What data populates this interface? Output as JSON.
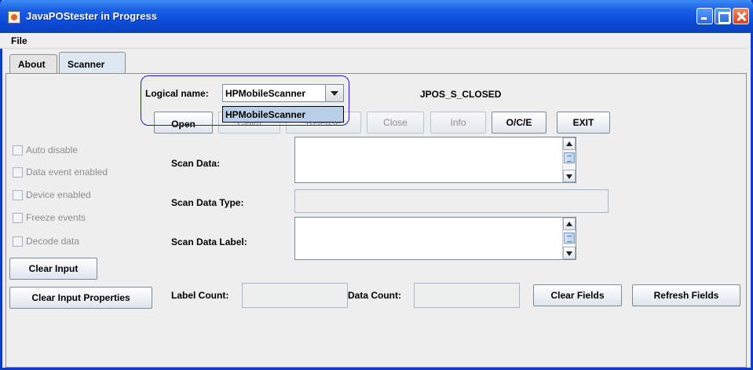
{
  "window": {
    "title": "JavaPOStester in Progress"
  },
  "menu": {
    "file": "File"
  },
  "tabs": [
    {
      "label": "About"
    },
    {
      "label": "Scanner"
    }
  ],
  "device": {
    "logical_name_label": "Logical name:",
    "logical_name_value": "HPMobileScanner",
    "dropdown_options": [
      "HPMobileScanner"
    ],
    "state": "JPOS_S_CLOSED"
  },
  "buttons": {
    "open": "Open",
    "claim": "Claim",
    "release": "Release",
    "close": "Close",
    "info": "Info",
    "oce": "O/C/E",
    "exit": "EXIT",
    "clear_input": "Clear Input",
    "clear_input_properties": "Clear Input Properties",
    "clear_fields": "Clear Fields",
    "refresh_fields": "Refresh Fields"
  },
  "checkboxes": [
    {
      "label": "Auto disable",
      "checked": false
    },
    {
      "label": "Data event enabled",
      "checked": false
    },
    {
      "label": "Device enabled",
      "checked": false
    },
    {
      "label": "Freeze events",
      "checked": false
    },
    {
      "label": "Decode data",
      "checked": false
    }
  ],
  "fields": {
    "scan_data_label": "Scan Data:",
    "scan_data_value": "",
    "scan_data_type_label": "Scan Data Type:",
    "scan_data_type_value": "",
    "scan_data_label_label": "Scan Data Label:",
    "scan_data_label_value": "",
    "label_count_label": "Label Count:",
    "label_count_value": "",
    "data_count_label": "Data Count:",
    "data_count_value": ""
  }
}
